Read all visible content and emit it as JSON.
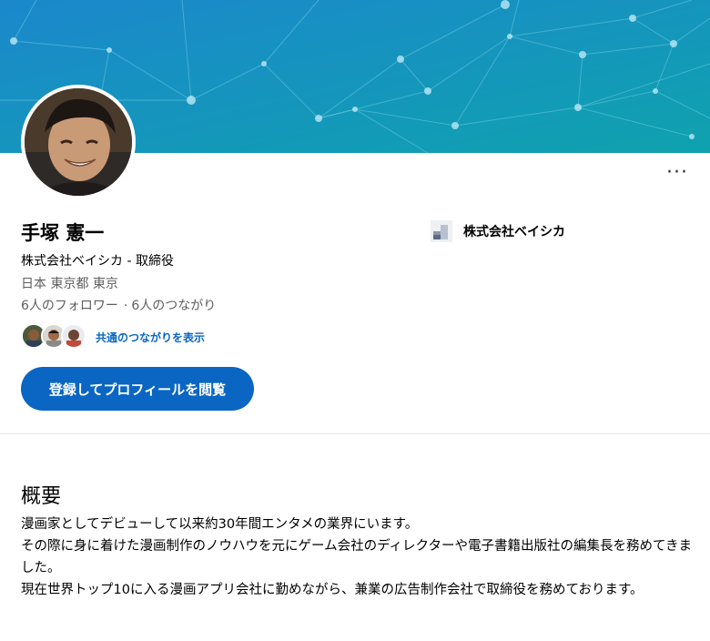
{
  "profile": {
    "name": "手塚 憲一",
    "headline": "株式会社ベイシカ - 取締役",
    "location": "日本 東京都 東京",
    "followers": "6人のフォロワー",
    "separator": "·",
    "connections": "6人のつながり",
    "mutual_label": "共通のつながりを表示",
    "cta_label": "登録してプロフィールを閲覧",
    "more_label": "···"
  },
  "company": {
    "name": "株式会社ベイシカ"
  },
  "about": {
    "title": "概要",
    "lines": [
      "漫画家としてデビューして以来約30年間エンタメの業界にいます。",
      "その際に身に着けた漫画制作のノウハウを元にゲーム会社のディレクターや電子書籍出版社の編集長を務めてきました。",
      "現在世界トップ10に入る漫画アプリ会社に勤めながら、兼業の広告制作会社で取締役を務めております。"
    ]
  },
  "colors": {
    "accent": "#0a66c2",
    "banner_from": "#1a8fc9",
    "banner_to": "#12a3b3",
    "muted_text": "#5e5e5e"
  },
  "icons": {
    "more": "more-horizontal-icon",
    "company": "company-logo-icon"
  }
}
